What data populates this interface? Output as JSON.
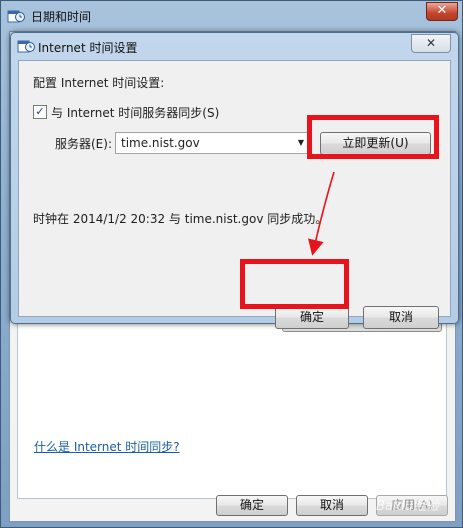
{
  "outer_window": {
    "title": "日期和时间",
    "close_glyph": "✕",
    "help_link": "什么是 Internet 时间同步?",
    "buttons": {
      "ok": "确定",
      "cancel": "取消",
      "apply": "应用(A)"
    },
    "watermark": "Baidu经验"
  },
  "dialog": {
    "title": "Internet 时间设置",
    "close_glyph": "✕",
    "heading": "配置 Internet 时间设置:",
    "sync_checkbox": {
      "checked": true,
      "mark": "✓",
      "label": "与 Internet 时间服务器同步(S)"
    },
    "server": {
      "label": "服务器(E):",
      "value": "time.nist.gov",
      "arrow": "▼"
    },
    "update_button": "立即更新(U)",
    "status": "时钟在 2014/1/2 20:32 与 time.nist.gov 同步成功。",
    "buttons": {
      "ok": "确定",
      "cancel": "取消"
    }
  },
  "annotation_color": "#e8141c"
}
